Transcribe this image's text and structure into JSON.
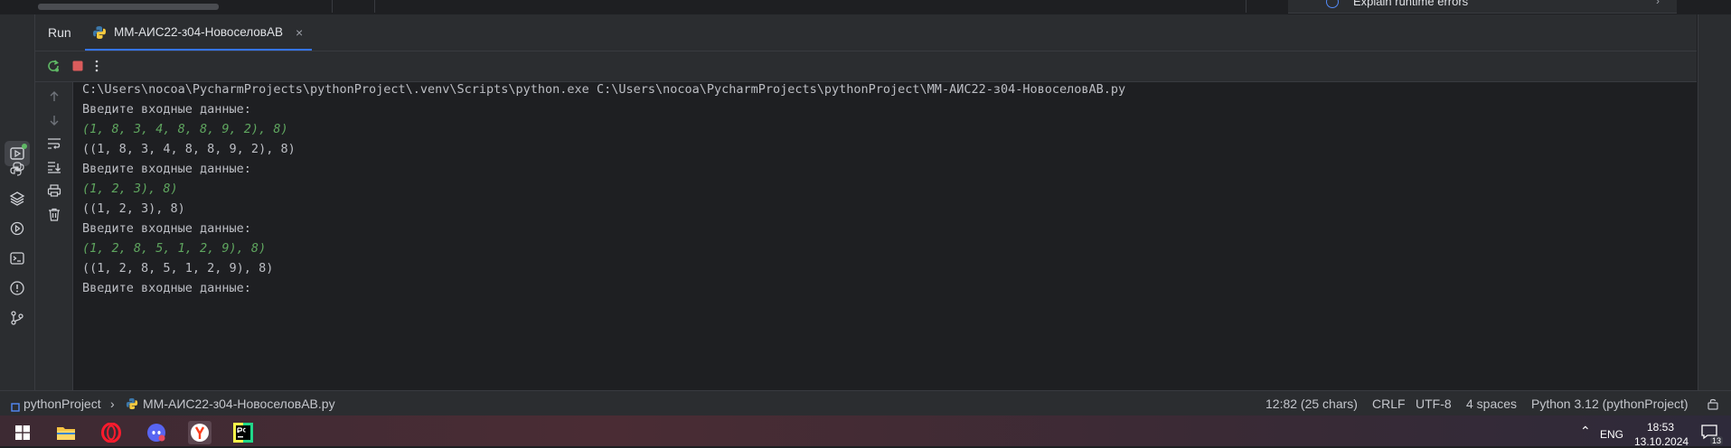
{
  "top_hint": {
    "text": "Explain runtime errors"
  },
  "run_panel": {
    "title": "Run",
    "tab_label": "ММ-АИС22-з04-НовоселовАВ",
    "close_glyph": "×"
  },
  "console": {
    "lines": [
      {
        "text": "C:\\Users\\nocoa\\PycharmProjects\\pythonProject\\.venv\\Scripts\\python.exe C:\\Users\\nocoa\\PycharmProjects\\pythonProject\\ММ-АИС22-з04-НовоселовАВ.py",
        "kind": "output"
      },
      {
        "text": "Введите входные данные:",
        "kind": "output"
      },
      {
        "text": "(1, 8, 3, 4, 8, 8, 9, 2), 8)",
        "kind": "input"
      },
      {
        "text": "((1, 8, 3, 4, 8, 8, 9, 2), 8)",
        "kind": "output"
      },
      {
        "text": "Введите входные данные:",
        "kind": "output"
      },
      {
        "text": "(1, 2, 3), 8)",
        "kind": "input"
      },
      {
        "text": "((1, 2, 3), 8)",
        "kind": "output"
      },
      {
        "text": "Введите входные данные:",
        "kind": "output"
      },
      {
        "text": "(1, 2, 8, 5, 1, 2, 9), 8)",
        "kind": "input"
      },
      {
        "text": "((1, 2, 8, 5, 1, 2, 9), 8)",
        "kind": "output"
      },
      {
        "text": "Введите входные данные:",
        "kind": "output"
      }
    ]
  },
  "status_bar": {
    "project": "pythonProject",
    "file": "ММ-АИС22-з04-НовоселовАВ.py",
    "position": "12:82 (25 chars)",
    "line_ending": "CRLF",
    "encoding": "UTF-8",
    "indent": "4 spaces",
    "interpreter": "Python 3.12 (pythonProject)"
  },
  "taskbar": {
    "language": "ENG",
    "time": "18:53",
    "date": "13.10.2024",
    "notification_count": "13"
  },
  "colors": {
    "accent": "#3574f0",
    "input_text": "#5fa65f",
    "stop_red": "#db5c5c",
    "run_green": "#5fb865"
  },
  "icons": {
    "left_bar": [
      "run-icon",
      "python-console-icon",
      "layers-icon",
      "services-icon",
      "terminal-icon",
      "problems-icon",
      "git-icon"
    ],
    "toolbar": [
      "rerun-icon",
      "stop-icon",
      "more-options-icon"
    ],
    "side_tools": [
      "up-arrow-icon",
      "down-arrow-icon",
      "soft-wrap-icon",
      "scroll-to-end-icon",
      "print-icon",
      "trash-icon"
    ]
  }
}
